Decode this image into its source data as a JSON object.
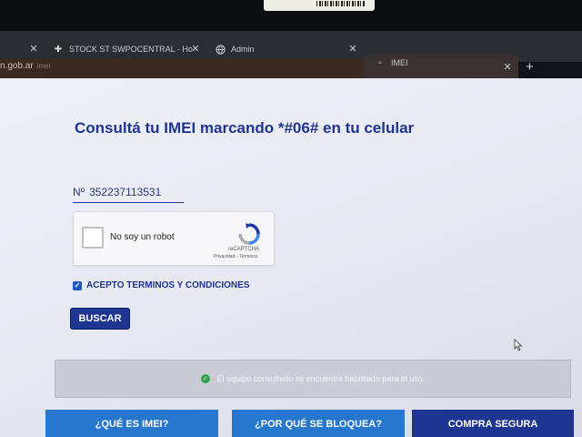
{
  "browser": {
    "tabs": [
      {
        "label": "STOCK ST SWPOCENTRAL - Ho",
        "icon": "plus-cross-icon"
      },
      {
        "label": "Admin",
        "icon": "globe-icon"
      },
      {
        "label": "IMEI",
        "icon": "page-icon",
        "active": true
      }
    ],
    "new_tab_symbol": "+",
    "address": "n.gob.ar",
    "address_suffix": "imei"
  },
  "page": {
    "title": "Consultá tu IMEI marcando *#06# en tu celular",
    "imei_label": "Nº",
    "imei_value": "352237113531",
    "captcha": {
      "label": "No soy un robot",
      "brand": "reCAPTCHA",
      "links": "Privacidad - Términos"
    },
    "terms_label": "ACEPTO TERMINOS Y CONDICIONES",
    "terms_checked": true,
    "search_button": "BUSCAR",
    "status_message": "El equipo consultado se encuentra habilitado para el uso.",
    "nav_buttons": [
      "¿QUÉ ES IMEI?",
      "¿POR QUÉ SE BLOQUEA?",
      "COMPRA SEGURA"
    ]
  },
  "colors": {
    "primary": "#1f3592",
    "accent": "#2877cf",
    "success": "#2aa34a"
  }
}
